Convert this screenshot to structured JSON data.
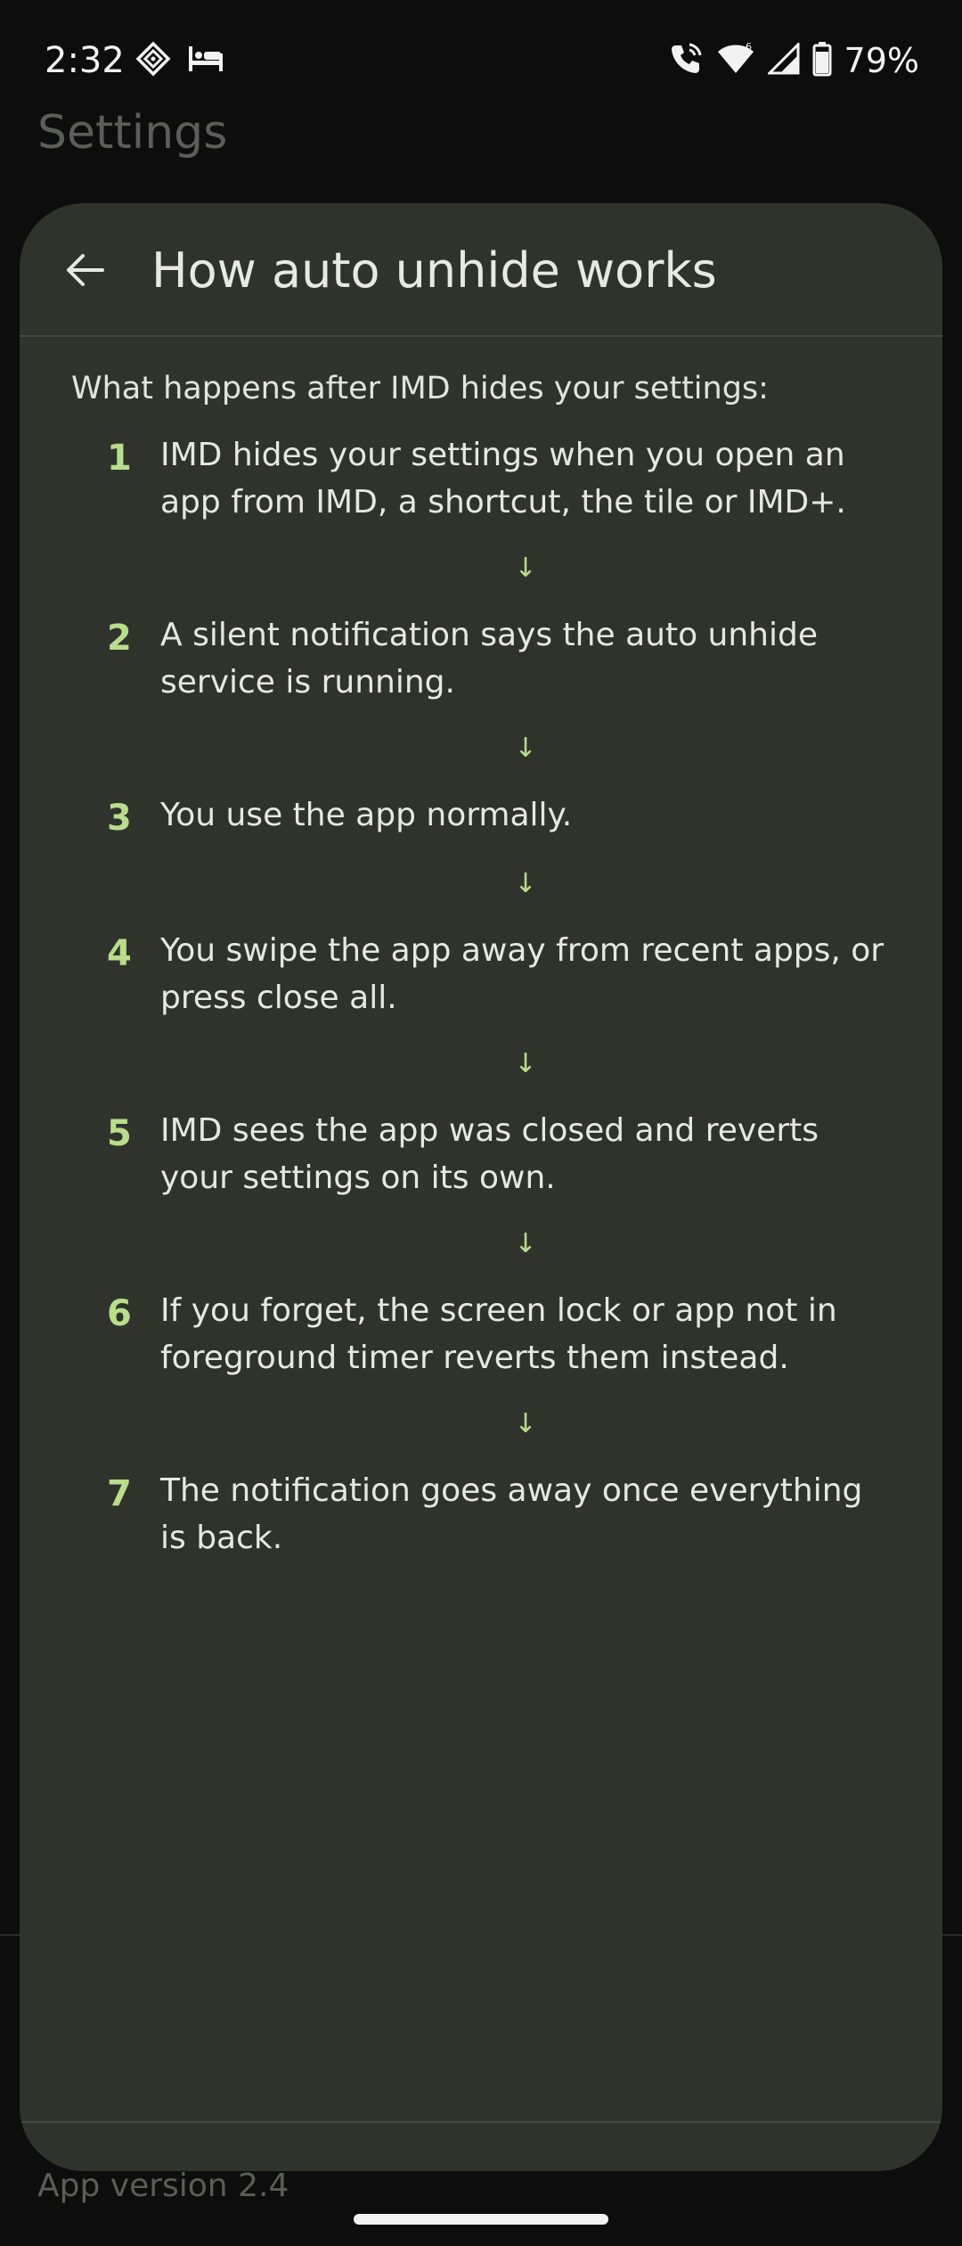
{
  "status_bar": {
    "time": "2:32",
    "battery": "79%",
    "icons": [
      "diamond-icon",
      "bed-icon",
      "phone-wifi-call-icon",
      "wifi-6-icon",
      "cell-signal-icon",
      "battery-icon"
    ]
  },
  "background": {
    "title": "Settings",
    "version": "App version 2.4"
  },
  "dialog": {
    "title": "How auto unhide works",
    "intro": "What happens after IMD hides your settings:",
    "steps": [
      {
        "num": "1",
        "text": "IMD hides your settings when you open an app from IMD, a shortcut, the tile or IMD+."
      },
      {
        "num": "2",
        "text": "A silent notification says the auto unhide service is running."
      },
      {
        "num": "3",
        "text": "You use the app normally."
      },
      {
        "num": "4",
        "text": "You swipe the app away from recent apps, or press close all."
      },
      {
        "num": "5",
        "text": "IMD sees the app was closed and reverts your settings on its own."
      },
      {
        "num": "6",
        "text": "If you forget, the screen lock or app not in foreground timer reverts them instead."
      },
      {
        "num": "7",
        "text": "The notification goes away once everything is back."
      }
    ],
    "arrow_glyph": "↓"
  },
  "colors": {
    "accent": "#b9dd8c",
    "dialog_bg": "#30332c",
    "screen_bg": "#0d0d0d"
  }
}
